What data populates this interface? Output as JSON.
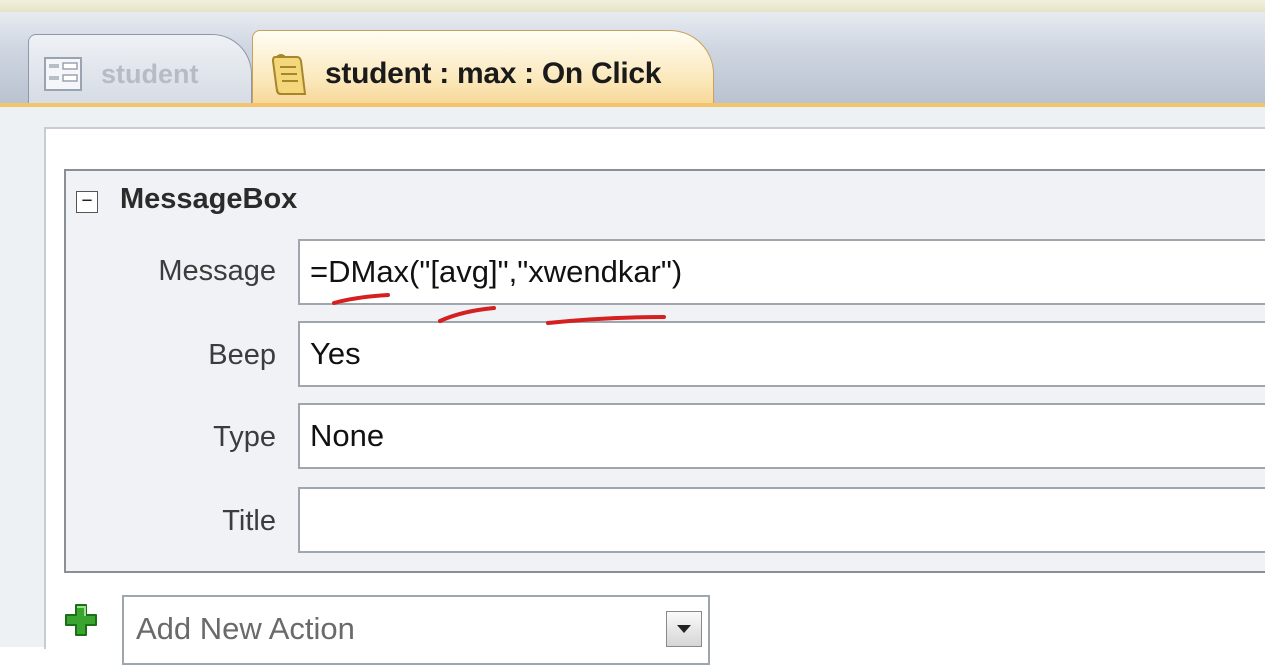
{
  "tabs": [
    {
      "label": "student",
      "icon": "form-icon",
      "active": false
    },
    {
      "label": "student : max : On Click",
      "icon": "macro-icon",
      "active": true
    }
  ],
  "action": {
    "name": "MessageBox",
    "collapse_symbol": "−",
    "arguments": [
      {
        "label": "Message",
        "value": "=DMax(\"[avg]\",\"xwendkar\")"
      },
      {
        "label": "Beep",
        "value": "Yes"
      },
      {
        "label": "Type",
        "value": "None"
      },
      {
        "label": "Title",
        "value": ""
      }
    ]
  },
  "add_action": {
    "placeholder": "Add New Action",
    "icon": "plus-icon",
    "dropdown_icon": "chevron-down-icon"
  },
  "colors": {
    "active_tab": "#fbe9bd",
    "tab_underline": "#f2c46b",
    "annotation": "#d42020",
    "plus": "#3aa52e"
  }
}
